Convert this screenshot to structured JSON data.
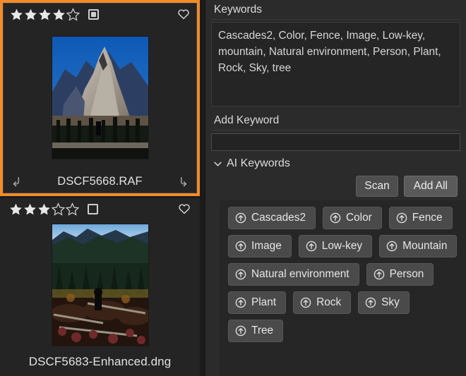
{
  "filmstrip": {
    "items": [
      {
        "filename": "DSCF5668.RAF",
        "rating": 4,
        "max_rating": 5,
        "checkbox_checked": true,
        "selected": true,
        "favorite_icon": "heart-icon",
        "left_icon": "rotate-left-icon",
        "right_icon": "rotate-right-icon",
        "photo_alt": "mountain-peak-thumbnail"
      },
      {
        "filename": "DSCF5683-Enhanced.dng",
        "rating": 3,
        "max_rating": 5,
        "checkbox_checked": false,
        "selected": false,
        "favorite_icon": "heart-icon",
        "photo_alt": "autumn-valley-thumbnail"
      }
    ]
  },
  "keywords_panel": {
    "keywords_label": "Keywords",
    "keywords_value": "Cascades2, Color, Fence, Image, Low-key, mountain, Natural environment, Person, Plant, Rock, Sky, tree",
    "add_keyword_label": "Add Keyword",
    "add_keyword_value": "",
    "add_keyword_placeholder": "",
    "ai_section": {
      "title": "AI Keywords",
      "expanded": true,
      "chevron_icon": "chevron-down-icon",
      "scan_label": "Scan",
      "add_all_label": "Add All",
      "chip_icon": "circled-up-arrow-icon",
      "chips": [
        "Cascades2",
        "Color",
        "Fence",
        "Image",
        "Low-key",
        "Mountain",
        "Natural environment",
        "Person",
        "Plant",
        "Rock",
        "Sky",
        "Tree"
      ]
    }
  },
  "colors": {
    "selection_accent": "#f28c28",
    "panel_bg": "#2b2b2b",
    "filmstrip_bg": "#1b1b1b",
    "chip_bg": "#4a4a4a",
    "text": "#d8d8d8"
  }
}
